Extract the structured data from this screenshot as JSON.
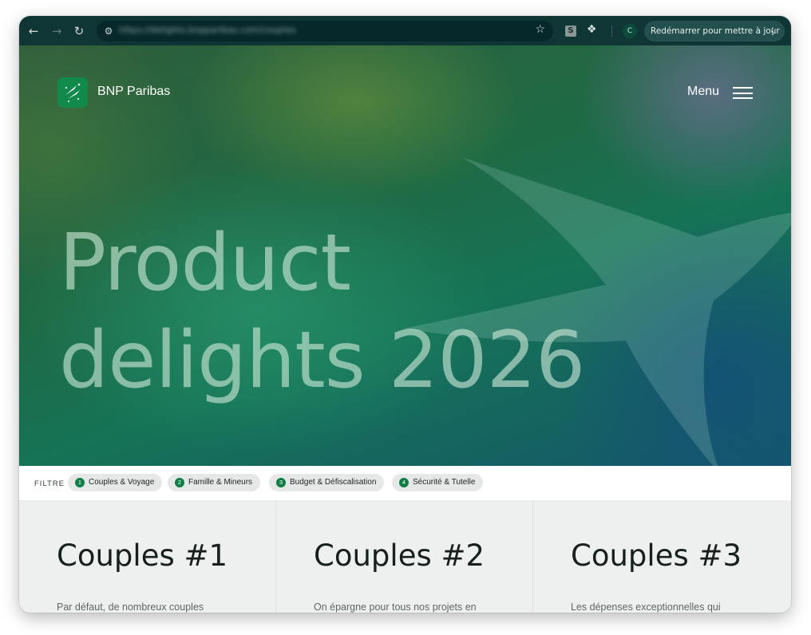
{
  "browser": {
    "url": "https://delights.bnpparibas.com/couples",
    "extension_badge": "S",
    "profile_initial": "C",
    "update_label": "Redémarrer pour mettre à jour"
  },
  "header": {
    "brand": "BNP Paribas",
    "menu_label": "Menu"
  },
  "hero": {
    "title_line1": "Product",
    "title_line2": "delights 2026"
  },
  "filter": {
    "label": "FILTRE",
    "chips": [
      {
        "num": "1",
        "label": "Couples & Voyage"
      },
      {
        "num": "2",
        "label": "Famille & Mineurs"
      },
      {
        "num": "3",
        "label": "Budget & Défiscalisation"
      },
      {
        "num": "4",
        "label": "Sécurité & Tutelle"
      }
    ]
  },
  "cards": [
    {
      "title": "Couples #1",
      "text": "Par défaut, de nombreux couples"
    },
    {
      "title": "Couples #2",
      "text": "On épargne pour tous nos projets en"
    },
    {
      "title": "Couples #3",
      "text": "Les dépenses exceptionnelles qui"
    }
  ],
  "colors": {
    "brand_green": "#118a4b",
    "chip_number": "#0f7d45",
    "toolbar": "#0f3535"
  }
}
